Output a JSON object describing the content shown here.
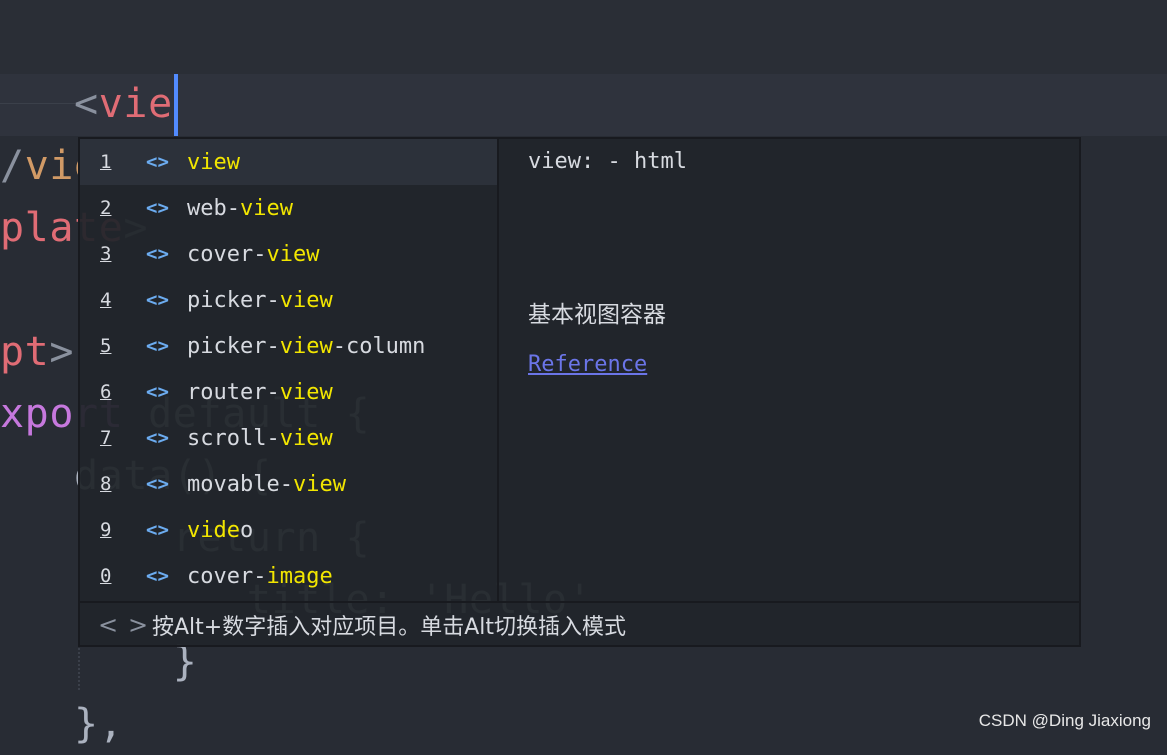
{
  "editor": {
    "lines": [
      {
        "parts": [
          {
            "t": "   ",
            "c": "w"
          },
          {
            "t": "<",
            "c": "g"
          },
          {
            "t": "vie",
            "c": "r"
          }
        ]
      },
      {
        "parts": [
          {
            "t": "/",
            "c": "g"
          },
          {
            "t": "view",
            "c": "o"
          },
          {
            "t": ">",
            "c": "g"
          }
        ]
      },
      {
        "parts": [
          {
            "t": "plate",
            "c": "r"
          },
          {
            "t": ">",
            "c": "g"
          }
        ]
      },
      {
        "parts": []
      },
      {
        "parts": [
          {
            "t": "pt",
            "c": "r"
          },
          {
            "t": ">",
            "c": "g"
          }
        ]
      },
      {
        "parts": [
          {
            "t": "xport",
            "c": "p"
          },
          {
            "t": " default {",
            "c": "w"
          }
        ]
      },
      {
        "parts": [
          {
            "t": "   data() {",
            "c": "w"
          }
        ]
      },
      {
        "parts": [
          {
            "t": "       return {",
            "c": "w"
          }
        ]
      },
      {
        "parts": [
          {
            "t": "          title: 'Hello'",
            "c": "w"
          }
        ]
      },
      {
        "parts": [
          {
            "t": "       }",
            "c": "w"
          }
        ]
      },
      {
        "parts": [
          {
            "t": "   },",
            "c": "w"
          }
        ]
      }
    ]
  },
  "autocomplete": {
    "items": [
      {
        "num": "1",
        "pre": "",
        "match": "view",
        "post": "",
        "selected": true
      },
      {
        "num": "2",
        "pre": "web-",
        "match": "view",
        "post": ""
      },
      {
        "num": "3",
        "pre": "cover-",
        "match": "view",
        "post": ""
      },
      {
        "num": "4",
        "pre": "picker-",
        "match": "view",
        "post": ""
      },
      {
        "num": "5",
        "pre": "picker-",
        "match": "view",
        "post": "-column"
      },
      {
        "num": "6",
        "pre": "router-",
        "match": "view",
        "post": ""
      },
      {
        "num": "7",
        "pre": "scroll-",
        "match": "view",
        "post": ""
      },
      {
        "num": "8",
        "pre": "movable-",
        "match": "view",
        "post": ""
      },
      {
        "num": "9",
        "pre": "",
        "match": "vide",
        "post": "o"
      },
      {
        "num": "0",
        "pre": "cover-",
        "match": "image",
        "post": ""
      }
    ],
    "item_icon": "tag-brackets-icon",
    "item_icon_glyph": "<>",
    "detail": {
      "signature": "view: - html",
      "description": "基本视图容器",
      "link": "Reference"
    },
    "footer": {
      "prev": "<",
      "next": ">",
      "hint": "按Alt+数字插入对应项目。单击Alt切换插入模式"
    }
  },
  "watermark": "CSDN @Ding Jiaxiong",
  "colors": {
    "match": "#f2e600",
    "cursor": "#528bff",
    "link": "#6b75e8"
  }
}
